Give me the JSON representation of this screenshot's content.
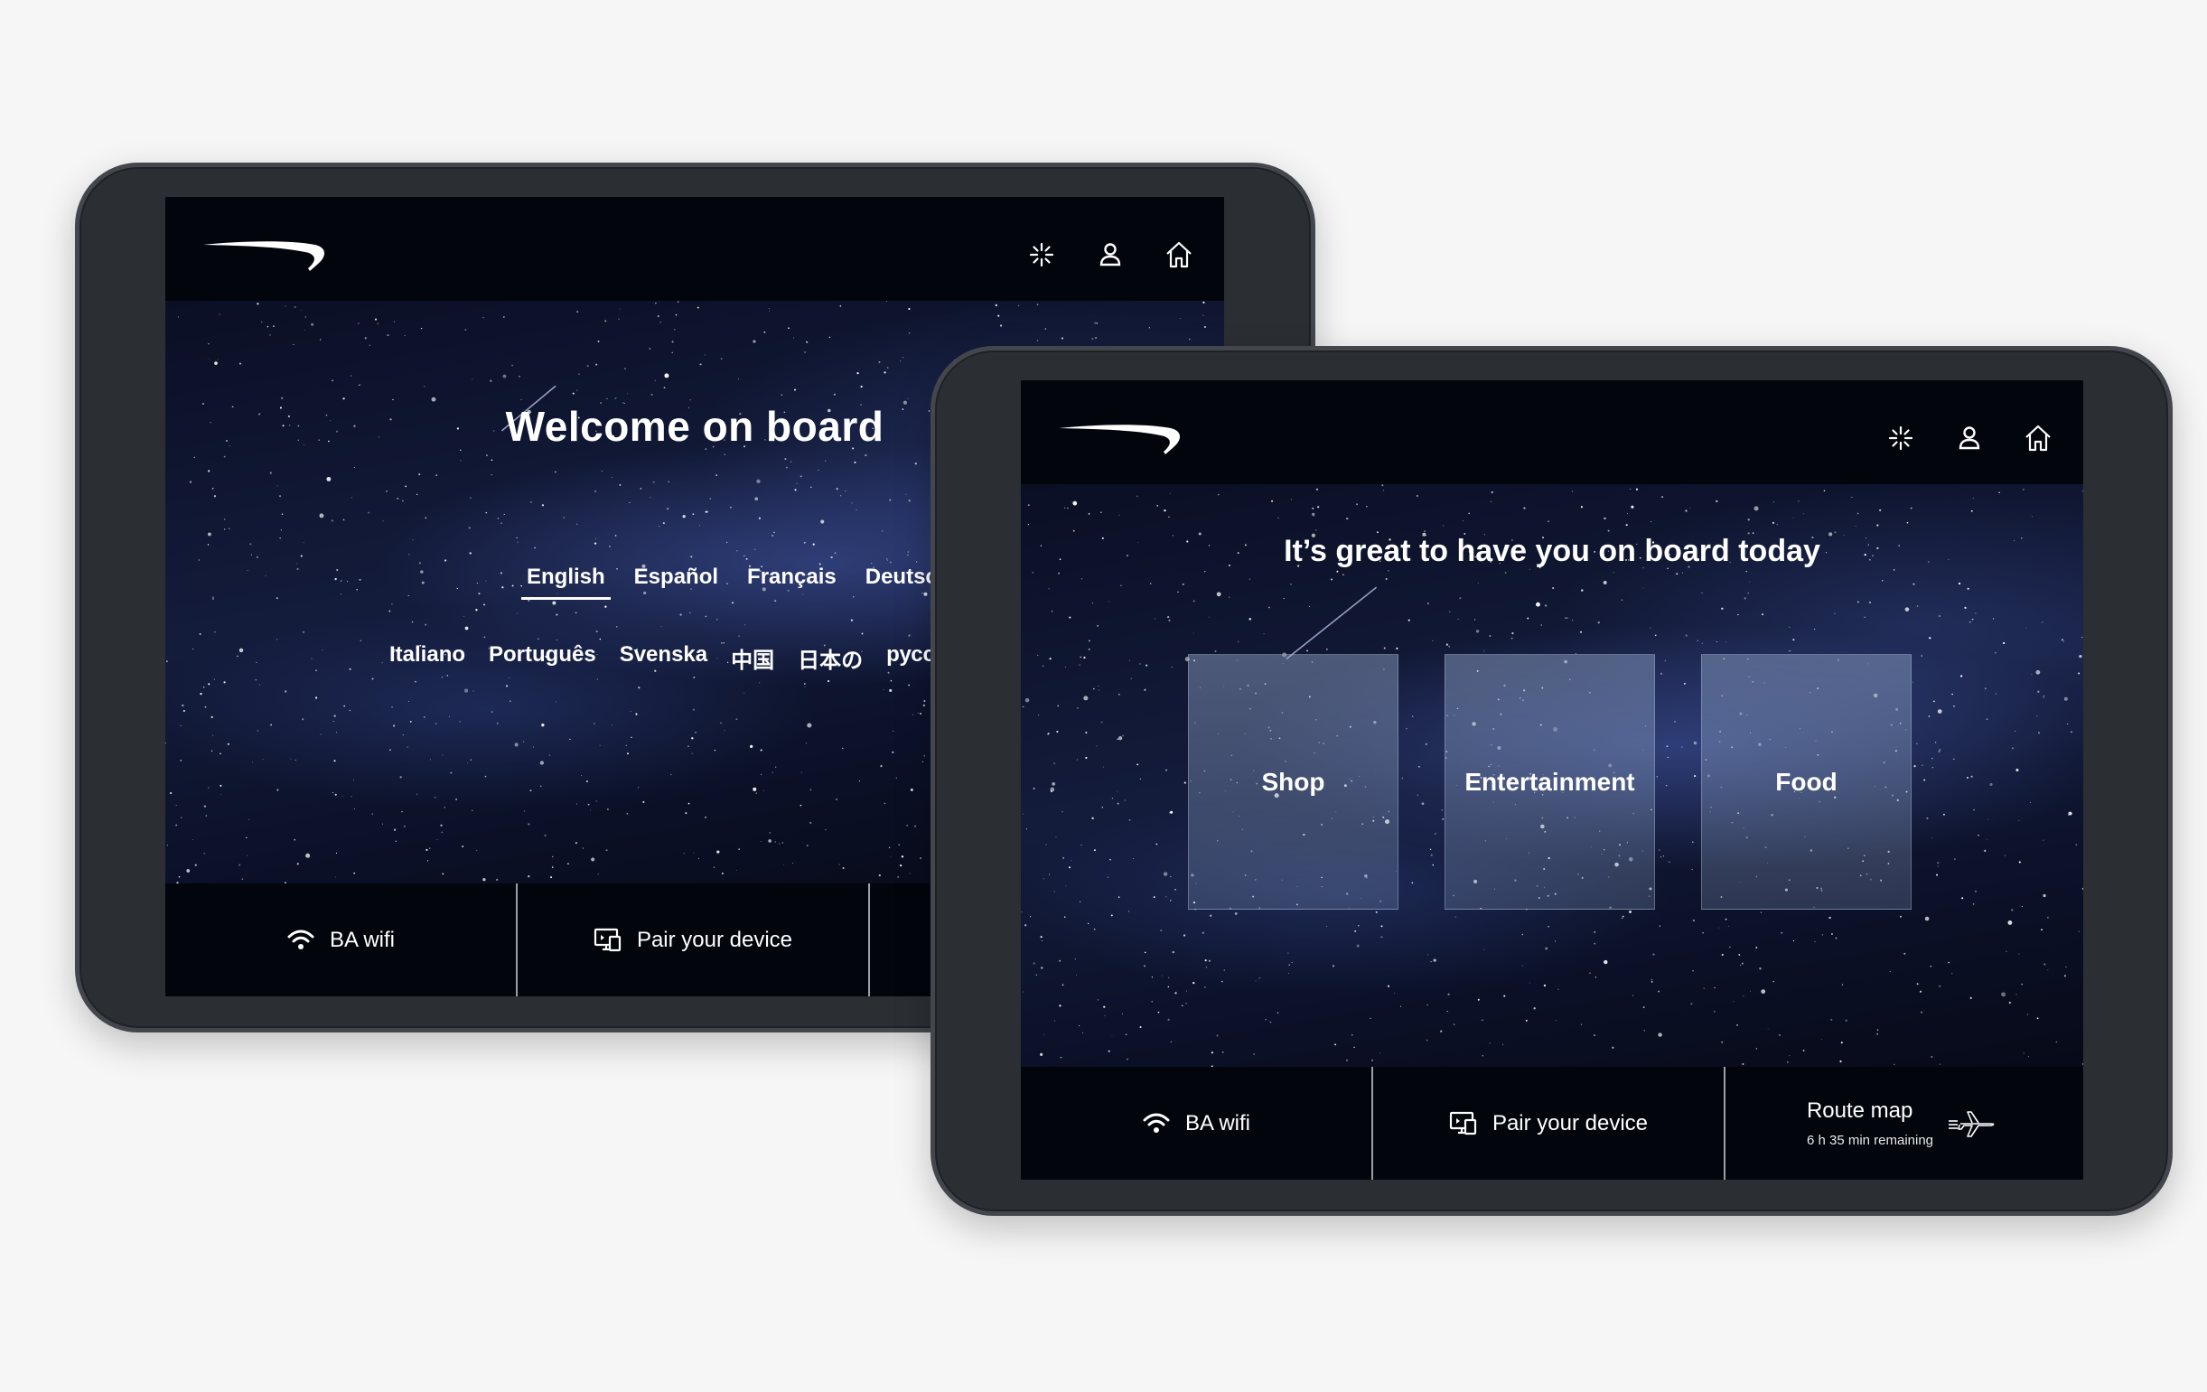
{
  "back_screen": {
    "heading": "Welcome on board",
    "languages_row1": [
      {
        "label": "English",
        "active": true
      },
      {
        "label": "Español",
        "active": false
      },
      {
        "label": "Français",
        "active": false
      },
      {
        "label": "Deutsch",
        "active": false
      }
    ],
    "languages_row2": [
      "Italiano",
      "Português",
      "Svenska",
      "中国",
      "日本の",
      "русски"
    ],
    "bottom_bar": {
      "wifi_label": "BA wifi",
      "pair_label": "Pair your device"
    },
    "header_icons": [
      "sparkle-icon",
      "user-icon",
      "home-icon"
    ]
  },
  "front_screen": {
    "heading": "It’s great to have you on board today",
    "tiles": [
      {
        "label": "Shop"
      },
      {
        "label": "Entertainment"
      },
      {
        "label": "Food"
      }
    ],
    "bottom_bar": {
      "wifi_label": "BA wifi",
      "pair_label": "Pair your device",
      "route_label": "Route map",
      "route_remaining": "6 h 35 min remaining"
    },
    "header_icons": [
      "sparkle-icon",
      "user-icon",
      "home-icon"
    ]
  },
  "colors": {
    "page_background": "#f6f6f6",
    "tablet_bezel": "#2b2e33",
    "screen_background": "#040610",
    "text": "#ffffff"
  }
}
